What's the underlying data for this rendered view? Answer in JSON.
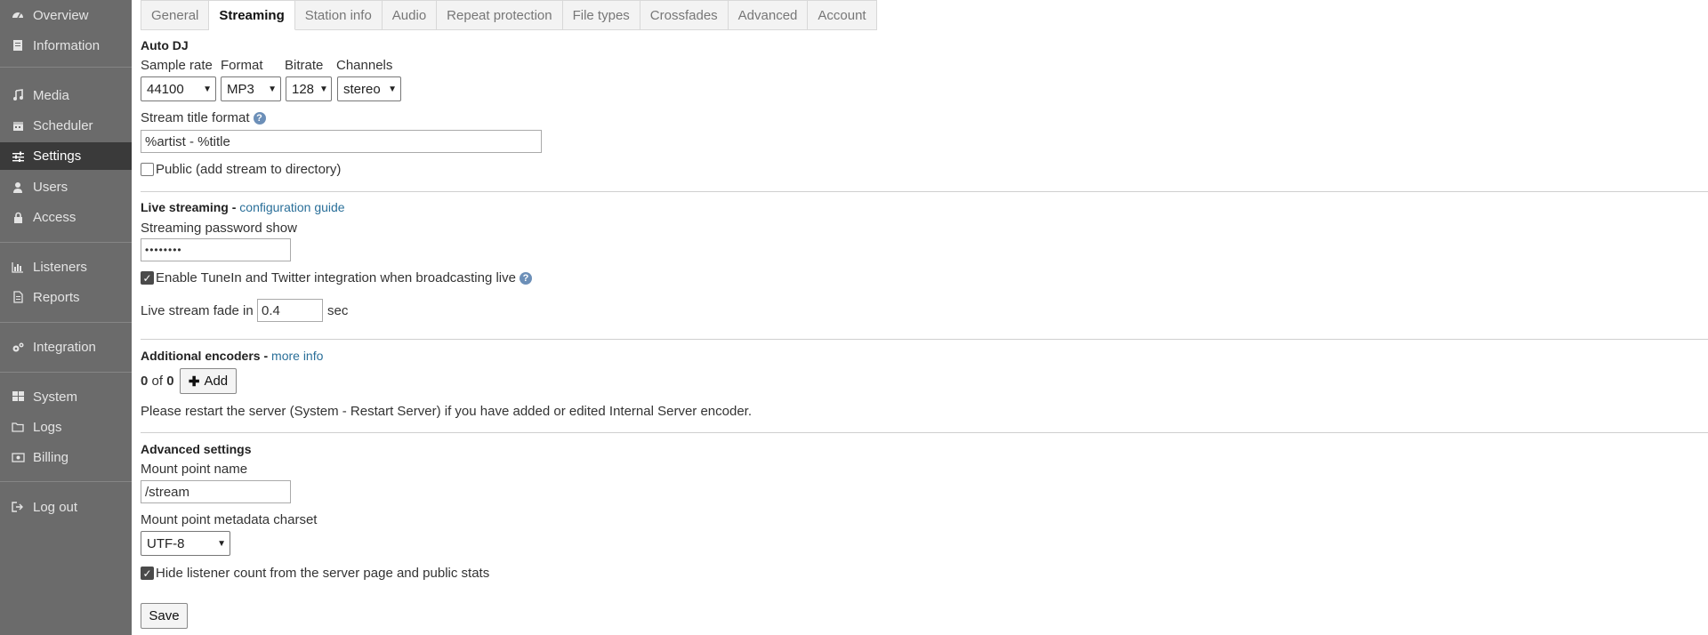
{
  "sidebar": {
    "items": [
      {
        "id": "overview",
        "label": "Overview",
        "icon": "dashboard-icon"
      },
      {
        "id": "information",
        "label": "Information",
        "icon": "book-icon"
      },
      {
        "id": "media",
        "label": "Media",
        "icon": "music-icon"
      },
      {
        "id": "scheduler",
        "label": "Scheduler",
        "icon": "calendar-icon"
      },
      {
        "id": "settings",
        "label": "Settings",
        "icon": "sliders-icon",
        "active": true
      },
      {
        "id": "users",
        "label": "Users",
        "icon": "user-icon"
      },
      {
        "id": "access",
        "label": "Access",
        "icon": "lock-icon"
      },
      {
        "id": "listeners",
        "label": "Listeners",
        "icon": "bar-chart-icon"
      },
      {
        "id": "reports",
        "label": "Reports",
        "icon": "document-icon"
      },
      {
        "id": "integration",
        "label": "Integration",
        "icon": "cogs-icon"
      },
      {
        "id": "system",
        "label": "System",
        "icon": "grid-icon"
      },
      {
        "id": "logs",
        "label": "Logs",
        "icon": "folder-icon"
      },
      {
        "id": "billing",
        "label": "Billing",
        "icon": "money-icon"
      },
      {
        "id": "logout",
        "label": "Log out",
        "icon": "sign-out-icon"
      }
    ]
  },
  "tabs": [
    "General",
    "Streaming",
    "Station info",
    "Audio",
    "Repeat protection",
    "File types",
    "Crossfades",
    "Advanced",
    "Account"
  ],
  "active_tab": "Streaming",
  "autodj": {
    "title": "Auto DJ",
    "sample_rate_label": "Sample rate",
    "format_label": "Format",
    "bitrate_label": "Bitrate",
    "channels_label": "Channels",
    "sample_rate": "44100",
    "format": "MP3",
    "bitrate": "128",
    "channels": "stereo",
    "stream_title_label": "Stream title format",
    "stream_title_value": "%artist - %title",
    "public_label": "Public (add stream to directory)",
    "public_checked": false
  },
  "live": {
    "title": "Live streaming",
    "separator": " - ",
    "guide_link": "configuration guide",
    "password_label": "Streaming password",
    "show_link": "show",
    "password_value": "••••••••",
    "tunein_label": "Enable TuneIn and Twitter integration when broadcasting live",
    "tunein_checked": true,
    "fade_label": "Live stream fade in",
    "fade_value": "0.4",
    "fade_unit": "sec"
  },
  "encoders": {
    "title": "Additional encoders",
    "separator": " - ",
    "more_link": "more info",
    "count_current": "0",
    "count_of": "of",
    "count_total": "0",
    "add_label": "Add",
    "restart_note": "Please restart the server (System - Restart Server) if you have added or edited Internal Server encoder."
  },
  "advanced": {
    "title": "Advanced settings",
    "mount_label": "Mount point name",
    "mount_value": "/stream",
    "charset_label": "Mount point metadata charset",
    "charset_value": "UTF-8",
    "hide_label": "Hide listener count from the server page and public stats",
    "hide_checked": true
  },
  "save_label": "Save",
  "colors": {
    "sidebar_bg": "#6b6b6b",
    "sidebar_active": "#3a3a3a",
    "link": "#2a6f99"
  }
}
